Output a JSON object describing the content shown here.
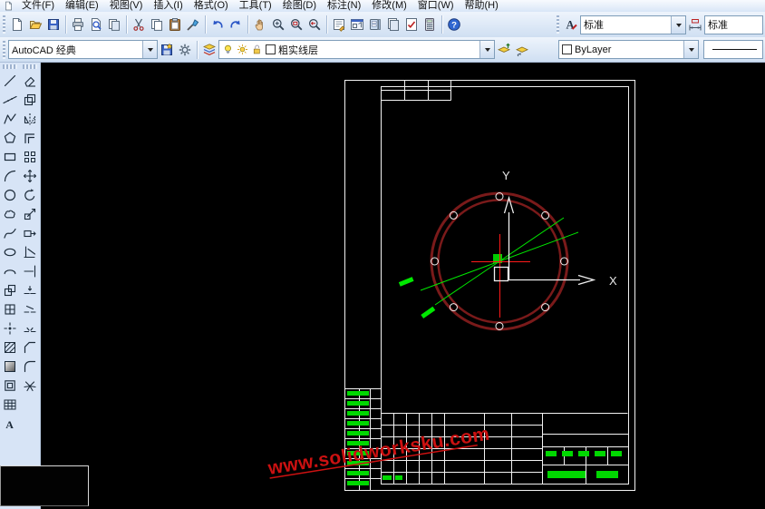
{
  "app": {
    "name": "AutoCAD"
  },
  "menu": {
    "items": [
      "文件(F)",
      "编辑(E)",
      "视图(V)",
      "插入(I)",
      "格式(O)",
      "工具(T)",
      "绘图(D)",
      "标注(N)",
      "修改(M)",
      "窗口(W)",
      "帮助(H)"
    ]
  },
  "standard_toolbar": {
    "groups": [
      [
        "new",
        "open",
        "save"
      ],
      [
        "plot",
        "plot-preview",
        "publish"
      ],
      [
        "cut",
        "copy",
        "paste",
        "match-properties"
      ],
      [
        "undo",
        "redo"
      ],
      [
        "pan",
        "zoom-realtime",
        "zoom-window",
        "zoom-previous"
      ],
      [
        "properties",
        "design-center",
        "tool-palettes",
        "sheet-set-manager",
        "markup-set-manager",
        "quick-calc"
      ],
      [
        "help"
      ]
    ]
  },
  "styles_toolbar": {
    "icons": [
      "text-style",
      "dim-style"
    ],
    "text_style_value": "标准",
    "dim_style_value": "标准"
  },
  "workspaces_toolbar": {
    "value": "AutoCAD 经典",
    "icons": [
      "save-workspace",
      "workspace-settings"
    ]
  },
  "layers_toolbar": {
    "left_icon": "layer-properties",
    "status_icons": [
      "light-bulb",
      "sun",
      "unlock",
      "layer-color-swatch"
    ],
    "current_layer": "粗实线层",
    "right_icons": [
      "make-object-layer",
      "layer-previous"
    ]
  },
  "properties_toolbar": {
    "color_value": "ByLayer",
    "linetype_sample": "continuous"
  },
  "draw_toolbar": {
    "icons": [
      "line",
      "construction-line",
      "polyline",
      "polygon",
      "rectangle",
      "arc",
      "circle",
      "revision-cloud",
      "spline",
      "ellipse",
      "ellipse-arc",
      "insert-block",
      "make-block",
      "point",
      "hatch",
      "gradient",
      "region",
      "table",
      "multiline-text"
    ]
  },
  "modify_toolbar": {
    "icons": [
      "erase",
      "copy",
      "mirror",
      "offset",
      "array",
      "move",
      "rotate",
      "scale",
      "stretch",
      "trim",
      "extend",
      "break-at-point",
      "break",
      "join",
      "chamfer",
      "fillet",
      "explode"
    ]
  },
  "drawing": {
    "watermark": "www.solidworksku.com",
    "ucs_x_label": "X",
    "ucs_y_label": "Y",
    "colors": {
      "flange_ring": "#7a1a1a",
      "dimension_green": "#00e800",
      "crosshair_red": "#ff1a1a",
      "frame_white": "#f2f2f2",
      "watermark_red": "#cc1111"
    }
  }
}
